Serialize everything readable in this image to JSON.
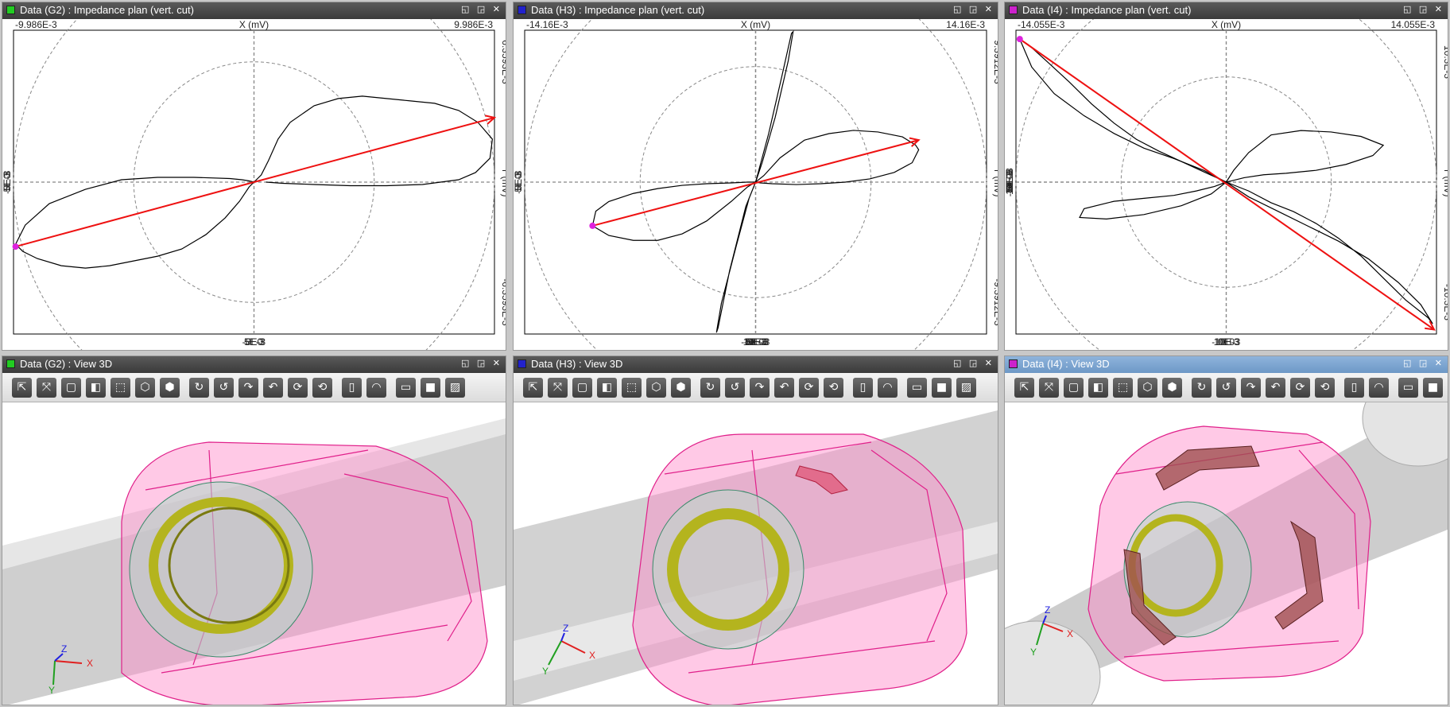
{
  "panels": {
    "g2_plot": {
      "title": "Data (G2) : Impedance plan (vert. cut)",
      "color": "#22cc22",
      "top_left": "-9.986E-3",
      "top_right": "9.986E-3",
      "xlabel": "X (mV)",
      "ylabel": "Y (mV)",
      "right_top": "6.3593E-3",
      "right_bottom": "-6.3593E-3",
      "yticks": [
        "5E-3",
        "0E0",
        "-5E-3"
      ],
      "xticks": [
        "-5E-3",
        "0E0",
        "5E-3"
      ]
    },
    "h3_plot": {
      "title": "Data (H3) : Impedance plan (vert. cut)",
      "color": "#2222cc",
      "top_left": "-14.16E-3",
      "top_right": "14.16E-3",
      "xlabel": "X (mV)",
      "ylabel": "Y (mV)",
      "right_top": "9.3912E-3",
      "right_bottom": "-9.3912E-3",
      "yticks": [
        "5E-3",
        "0E0",
        "-5E-3"
      ],
      "xticks": [
        "-10E-3",
        "-5E-3",
        "0E0",
        "5E-3",
        "10E-3"
      ]
    },
    "i4_plot": {
      "title": "Data (I4) : Impedance plan (vert. cut)",
      "color": "#cc22cc",
      "top_left": "-14.055E-3",
      "top_right": "14.055E-3",
      "xlabel": "X (mV)",
      "ylabel": "Y (mV)",
      "right_top": "10.3E-3",
      "right_bottom": "-10.3E-3",
      "yticks": [
        "10E-3",
        "5E-3",
        "0E0",
        "-5E-3",
        "-10E-3"
      ],
      "xticks": [
        "-10E-3",
        "0E0",
        "10E-3"
      ]
    },
    "g2_view": {
      "title": "Data (G2) : View 3D",
      "color": "#22cc22"
    },
    "h3_view": {
      "title": "Data (H3) : View 3D",
      "color": "#2222cc"
    },
    "i4_view": {
      "title": "Data (I4) : View 3D",
      "color": "#cc22cc"
    }
  },
  "window_buttons": "◱ ◲ ✕",
  "axes": {
    "x": "X",
    "y": "Y",
    "z": "Z"
  },
  "toolbar_icons": [
    "pointer-icon",
    "fit-all-icon",
    "cube-front-icon",
    "cube-top-icon",
    "cube-wire-icon",
    "cube-iso-icon",
    "cube-solid-icon",
    "rotate-cw-icon",
    "rotate-ccw-icon",
    "rotate-left-icon",
    "rotate-right-icon",
    "rotate-up-icon",
    "rotate-down-icon",
    "cut-plane-icon",
    "protractor-icon",
    "box-outline-icon",
    "box-fill-icon",
    "hatch-icon"
  ],
  "toolbar_glyphs": [
    "⇱",
    "⤧",
    "▢",
    "◧",
    "⬚",
    "⬡",
    "⬢",
    "↻",
    "↺",
    "↷",
    "↶",
    "⟳",
    "⟲",
    "▯",
    "◠",
    "▭",
    "■",
    "▨"
  ],
  "colors": {
    "trace": "#000000",
    "vector": "#ee1111",
    "marker": "#dd22dd",
    "grid": "#888888",
    "coil": "#b4b41e",
    "pipe": "#d0d0d0",
    "tool": "#ff66b8"
  },
  "chart_data": [
    {
      "type": "line",
      "panel": "G2",
      "title": "Data (G2) : Impedance plan (vert. cut)",
      "xlabel": "X (mV)",
      "ylabel": "Y (mV)",
      "xlim": [
        -9.986,
        9.986
      ],
      "ylim": [
        -6.3593,
        6.3593
      ],
      "units_scale": "E-3",
      "grid": true,
      "series": [
        {
          "x": [
            -9.9,
            -9.6,
            -9.0,
            -8.0,
            -7.0,
            -6.0,
            -5.0,
            -4.0,
            -3.0,
            -2.0,
            -1.2,
            -0.6,
            -0.2,
            0.0,
            0.3,
            0.6,
            1.0,
            1.5,
            2.5,
            3.5,
            4.5,
            5.5,
            6.5,
            7.5,
            8.5,
            9.3,
            9.9,
            9.8,
            9.2,
            8.5,
            7.0,
            5.5,
            4.0,
            2.5,
            1.2,
            0.5
          ],
          "y": [
            -2.6,
            -2.9,
            -3.2,
            -3.5,
            -3.6,
            -3.5,
            -3.3,
            -3.1,
            -2.8,
            -2.2,
            -1.5,
            -0.8,
            -0.2,
            0.0,
            0.3,
            0.9,
            1.8,
            2.5,
            3.2,
            3.5,
            3.6,
            3.5,
            3.4,
            3.3,
            3.0,
            2.5,
            1.8,
            1.0,
            0.4,
            0.1,
            -0.1,
            -0.15,
            -0.15,
            -0.1,
            -0.05,
            0.0
          ]
        },
        {
          "x": [
            -9.9,
            -9.5,
            -8.5,
            -7.0,
            -5.5,
            -4.0,
            -2.5,
            -1.0,
            -0.5,
            -0.2,
            0.0
          ],
          "y": [
            -2.6,
            -1.8,
            -0.9,
            -0.3,
            0.1,
            0.2,
            0.2,
            0.15,
            0.1,
            0.05,
            0.0
          ]
        },
        {
          "x": [
            0.0,
            9.986
          ],
          "y": [
            0.0,
            2.7
          ]
        },
        {
          "x": [
            -9.9,
            0.0
          ],
          "y": [
            -2.7,
            0.0
          ]
        }
      ]
    },
    {
      "type": "line",
      "panel": "H3",
      "title": "Data (H3) : Impedance plan (vert. cut)",
      "xlabel": "X (mV)",
      "ylabel": "Y (mV)",
      "xlim": [
        -14.16,
        14.16
      ],
      "ylim": [
        -9.3912,
        9.3912
      ],
      "units_scale": "E-3",
      "grid": true,
      "series": [
        {
          "x": [
            -10.0,
            -9.8,
            -9.0,
            -7.5,
            -6.0,
            -4.5,
            -3.0,
            -1.5,
            -0.5,
            0.0,
            0.5,
            1.5,
            3.0,
            4.5,
            6.0,
            7.5,
            9.0,
            9.8,
            10.0,
            9.6,
            8.5,
            7.0,
            5.5,
            4.0,
            2.5,
            1.0,
            0.3,
            0.0
          ],
          "y": [
            -2.7,
            -1.8,
            -1.2,
            -0.7,
            -0.4,
            -0.2,
            -0.1,
            -0.05,
            0.0,
            0.0,
            0.4,
            1.5,
            2.6,
            3.0,
            3.2,
            3.1,
            2.8,
            2.3,
            2.0,
            1.2,
            0.6,
            0.2,
            0.0,
            -0.1,
            -0.15,
            -0.1,
            -0.05,
            0.0
          ]
        },
        {
          "x": [
            -10.0,
            -9.0,
            -7.5,
            -6.0,
            -4.5,
            -3.0,
            -1.5,
            -0.5,
            0.0
          ],
          "y": [
            -2.7,
            -3.3,
            -3.6,
            -3.6,
            -3.2,
            -2.4,
            -1.2,
            -0.3,
            0.0
          ]
        },
        {
          "x": [
            0.0,
            0.8,
            1.6,
            2.2,
            2.3,
            2.0,
            1.2,
            0.4,
            0.0,
            -0.6,
            -1.6,
            -2.3,
            -2.4,
            -2.1,
            -1.2,
            -0.4,
            0.0
          ],
          "y": [
            0.0,
            3.0,
            6.5,
            9.2,
            9.3,
            7.5,
            4.0,
            1.2,
            0.0,
            -1.5,
            -5.5,
            -9.0,
            -9.3,
            -7.5,
            -4.0,
            -1.0,
            0.0
          ]
        },
        {
          "x": [
            -10.0,
            10.0
          ],
          "y": [
            -2.7,
            2.6
          ]
        }
      ]
    },
    {
      "type": "line",
      "panel": "I4",
      "title": "Data (I4) : Impedance plan (vert. cut)",
      "xlabel": "X (mV)",
      "ylabel": "Y (mV)",
      "xlim": [
        -14.055,
        14.055
      ],
      "ylim": [
        -10.3,
        10.3
      ],
      "units_scale": "E-3",
      "grid": true,
      "series": [
        {
          "x": [
            -13.8,
            -13.0,
            -11.5,
            -9.5,
            -7.5,
            -5.5,
            -3.5,
            -1.5,
            0.0,
            1.5,
            3.5,
            5.5,
            7.5,
            9.5,
            11.5,
            13.0,
            13.8,
            13.5,
            12.0,
            10.5,
            9.0,
            7.5,
            6.0,
            4.5,
            3.0,
            1.5,
            0.0
          ],
          "y": [
            9.7,
            7.8,
            6.0,
            4.5,
            3.3,
            2.3,
            1.6,
            0.8,
            0.0,
            -1.0,
            -2.0,
            -3.0,
            -4.0,
            -5.2,
            -6.8,
            -8.3,
            -9.6,
            -9.2,
            -8.0,
            -6.5,
            -5.0,
            -3.8,
            -2.8,
            -2.0,
            -1.4,
            -0.6,
            0.0
          ]
        },
        {
          "x": [
            -13.8,
            -13.2,
            -12.0,
            -10.5,
            -9.0,
            -7.5,
            -6.0,
            -4.5,
            -3.0,
            -1.5,
            0.0
          ],
          "y": [
            9.7,
            9.3,
            8.2,
            6.8,
            5.3,
            4.0,
            2.9,
            2.1,
            1.4,
            0.7,
            0.0
          ]
        },
        {
          "x": [
            0.0,
            0.5,
            1.5,
            3.0,
            5.0,
            7.0,
            9.0,
            10.5,
            9.8,
            8.0,
            6.0,
            4.0,
            2.5,
            1.2,
            0.4,
            0.0
          ],
          "y": [
            0.0,
            0.8,
            2.0,
            3.2,
            3.5,
            3.4,
            3.1,
            2.5,
            1.8,
            1.2,
            0.8,
            0.6,
            0.5,
            0.3,
            0.1,
            0.0
          ]
        },
        {
          "x": [
            0.0,
            -1.0,
            -3.0,
            -5.5,
            -8.0,
            -9.8,
            -9.5,
            -7.5,
            -5.5,
            -3.5,
            -2.0,
            -0.8,
            0.0
          ],
          "y": [
            0.0,
            -0.8,
            -1.6,
            -2.2,
            -2.5,
            -2.4,
            -1.8,
            -1.3,
            -1.1,
            -0.9,
            -0.6,
            -0.3,
            0.0
          ]
        },
        {
          "x": [
            -13.8,
            13.9
          ],
          "y": [
            9.7,
            -10.0
          ]
        }
      ]
    }
  ]
}
